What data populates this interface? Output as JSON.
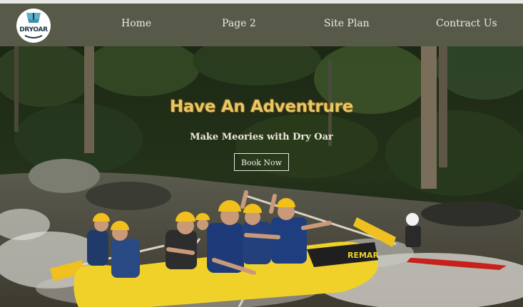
{
  "logo": {
    "text": "DRYOAR"
  },
  "nav": {
    "items": [
      {
        "label": "Home"
      },
      {
        "label": "Page 2"
      },
      {
        "label": "Site Plan"
      },
      {
        "label": "Contract Us"
      }
    ]
  },
  "hero": {
    "title": "Have An Adventrure",
    "subtitle": "Make Meories with Dry Oar",
    "cta_label": "Book Now",
    "raft_print": "REMAR"
  },
  "colors": {
    "navbar": "#575a48",
    "title_gold": "#e8c766",
    "raft_yellow": "#f0d12a",
    "helmet_yellow": "#f2c01c"
  }
}
